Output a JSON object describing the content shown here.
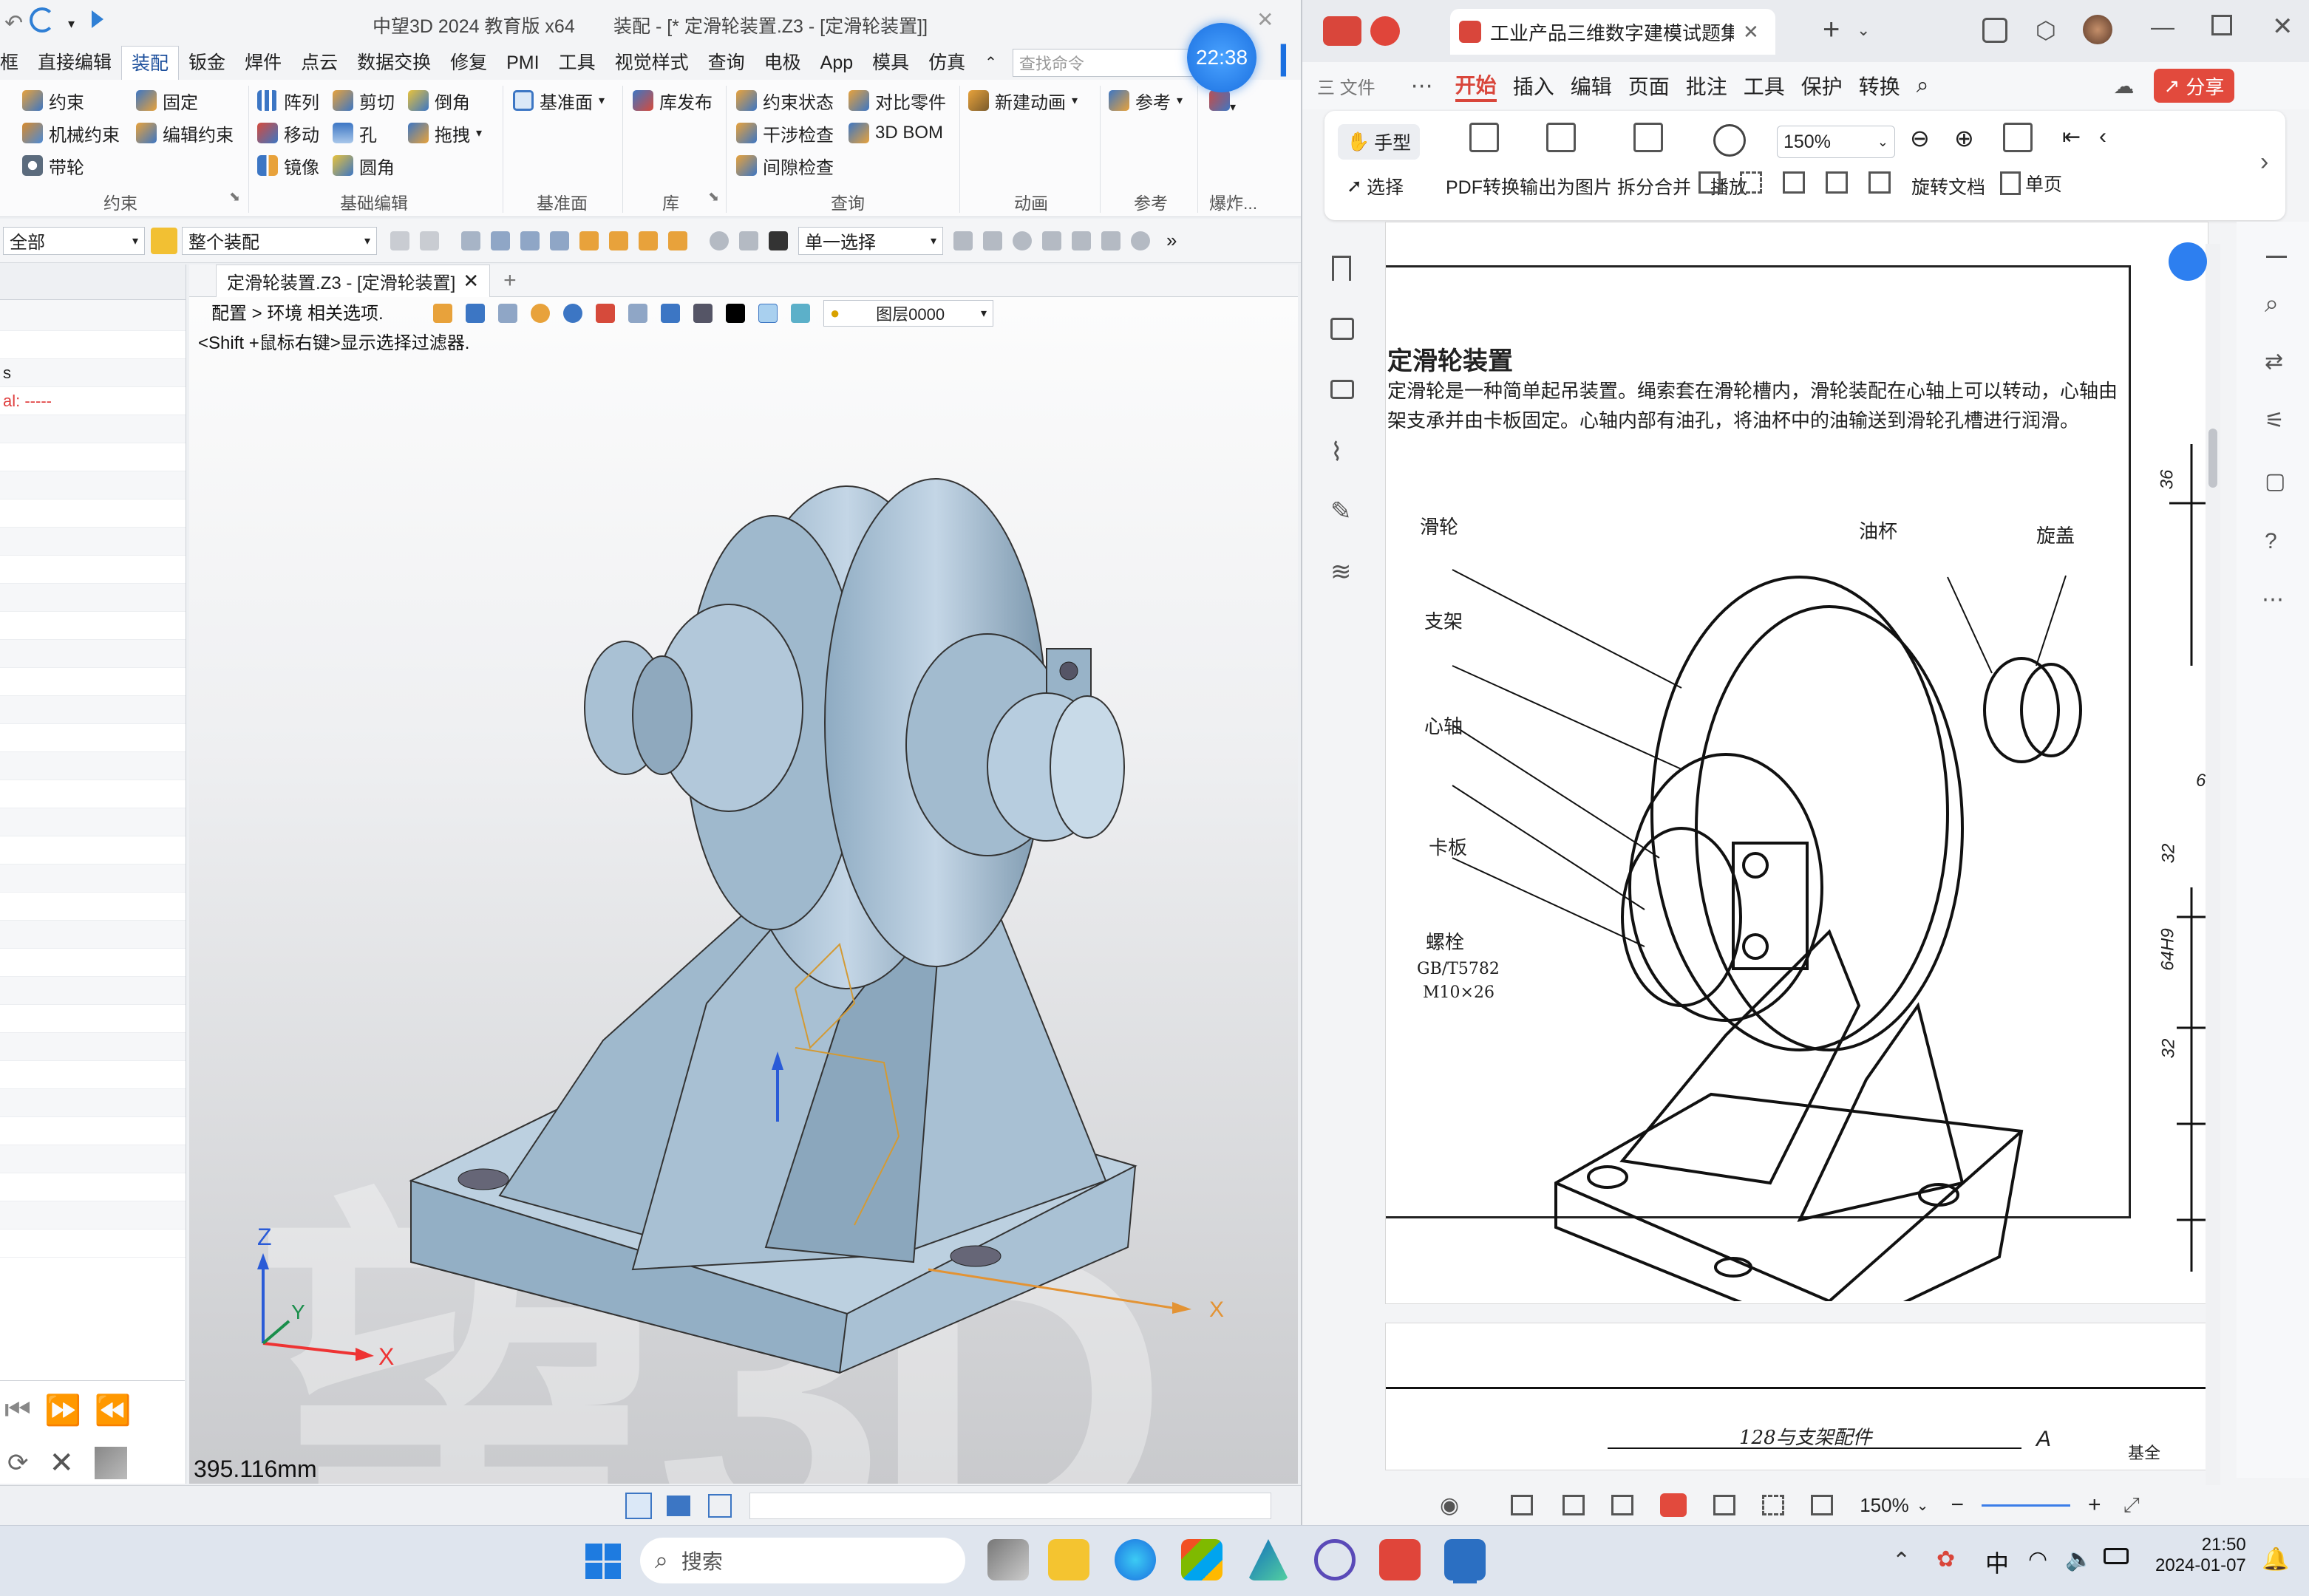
{
  "left_app": {
    "title": "中望3D  2024 教育版 x64",
    "doc_title": "装配 - [* 定滑轮装置.Z3 - [定滑轮装置]]",
    "menu": [
      "直接编辑",
      "装配",
      "钣金",
      "焊件",
      "点云",
      "数据交换",
      "修复",
      "PMI",
      "工具",
      "视觉样式",
      "查询",
      "电极",
      "App",
      "模具",
      "仿真"
    ],
    "search_placeholder": "查找命令",
    "ribbon": {
      "col1": [
        "约束",
        "机械约束",
        "带轮"
      ],
      "col2": [
        "固定",
        "编辑约束"
      ],
      "col3": [
        "阵列",
        "移动",
        "镜像"
      ],
      "col4": [
        "剪切",
        "孔",
        "圆角"
      ],
      "col5": [
        "倒角",
        "拖拽"
      ],
      "col6": [
        "基准面"
      ],
      "col7": [
        "库发布"
      ],
      "col8": [
        "约束状态",
        "干涉检查",
        "间隙检查"
      ],
      "col9": [
        "对比零件",
        "3D BOM"
      ],
      "col10": [
        "新建动画"
      ],
      "col11": [
        "参考"
      ],
      "groups": [
        "约束",
        "基础编辑",
        "基准面",
        "库",
        "查询",
        "动画",
        "参考",
        "爆炸..."
      ]
    },
    "toolbar2": {
      "filter": "全部",
      "scope": "整个装配",
      "select_mode": "单一选择"
    },
    "tab": "定滑轮装置.Z3 - [定滑轮装置]",
    "hint_line1": "<Shift +鼠标右键>显示选择过滤器.",
    "hint_top": "配置 > 环境 相关选项.",
    "layer": "图层0000",
    "left_panel_text": [
      "s",
      "al: -----"
    ],
    "measure": "395.116mm",
    "axes": {
      "x": "X",
      "y": "Y",
      "z": "Z"
    },
    "watermark": "望3D"
  },
  "recorder": {
    "time": "22:38"
  },
  "right_app": {
    "tab_title": "工业产品三维数字建模试题集",
    "menu": [
      "开始",
      "插入",
      "编辑",
      "页面",
      "批注",
      "工具",
      "保护",
      "转换"
    ],
    "share": "分享",
    "tools": {
      "hand": "手型",
      "select": "选择",
      "pdf_convert": "PDF转换",
      "export_img": "输出为图片",
      "split_merge": "拆分合并",
      "play": "播放",
      "zoom": "150%",
      "rotate": "旋转文档",
      "single": "单页"
    },
    "doc": {
      "heading": "定滑轮装置",
      "para1": "定滑轮是一种简单起吊装置。绳索套在滑轮槽内，滑轮装配在心轴上可以转动，心轴由",
      "para2": "架支承并由卡板固定。心轴内部有油孔，将油杯中的油输送到滑轮孔槽进行润滑。",
      "labels": {
        "pulley": "滑轮",
        "bracket": "支架",
        "shaft": "心轴",
        "plate": "卡板",
        "bolt": "螺栓",
        "bolt_spec1": "GB/T5782",
        "bolt_spec2": "M10×26",
        "oilcup": "油杯",
        "cap": "旋盖"
      },
      "dims": [
        "36",
        "6.",
        "32",
        "64H9",
        "32"
      ],
      "page2_text": "128与支架配件",
      "page2_a": "A",
      "page2_b": "基全"
    },
    "status_zoom": "150%"
  },
  "taskbar": {
    "search": "搜索",
    "time": "21:50",
    "date": "2024-01-07",
    "ime": "中"
  }
}
